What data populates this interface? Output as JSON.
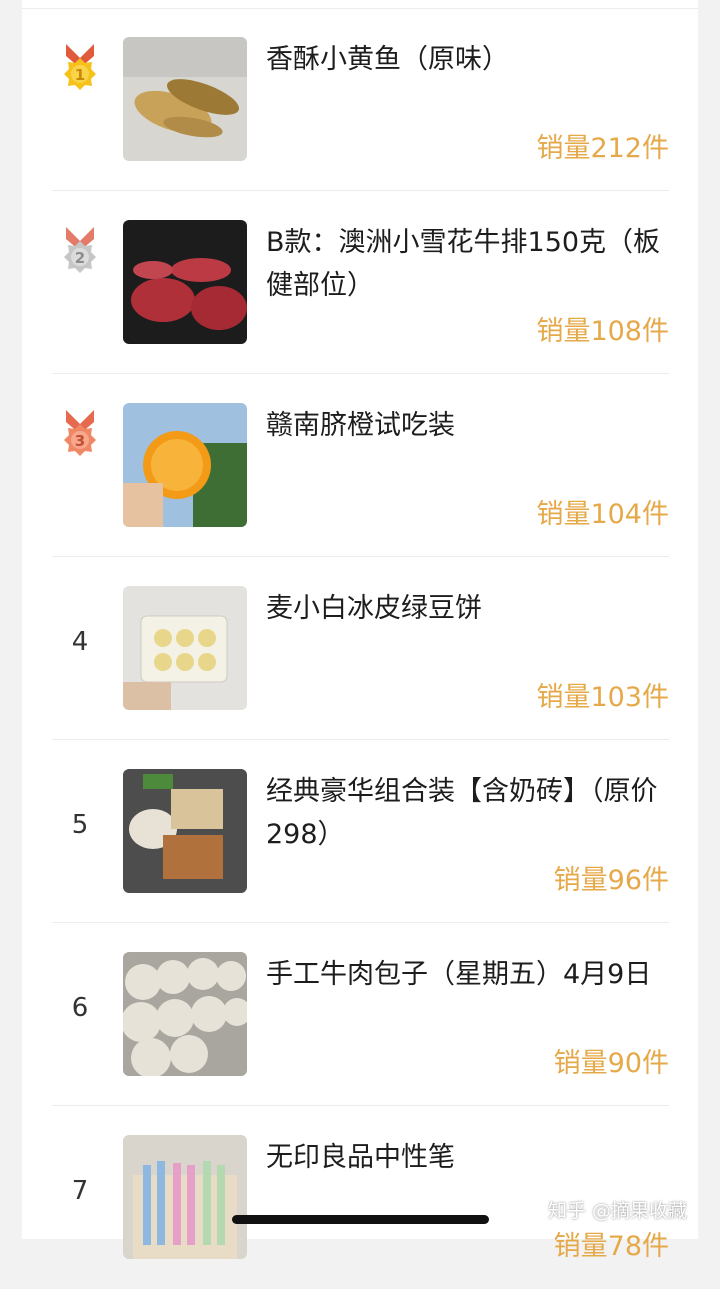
{
  "list": {
    "items": [
      {
        "rank": "1",
        "title": "香酥小黄鱼（原味）",
        "sales": "销量212件",
        "icon": "gold-medal-icon"
      },
      {
        "rank": "2",
        "title": "B款：澳洲小雪花牛排150克（板健部位）",
        "sales": "销量108件",
        "icon": "silver-medal-icon"
      },
      {
        "rank": "3",
        "title": "赣南脐橙试吃装",
        "sales": "销量104件",
        "icon": "bronze-medal-icon"
      },
      {
        "rank": "4",
        "title": "麦小白冰皮绿豆饼",
        "sales": "销量103件"
      },
      {
        "rank": "5",
        "title": "经典豪华组合装【含奶砖】（原价298）",
        "sales": "销量96件"
      },
      {
        "rank": "6",
        "title": "手工牛肉包子（星期五）4月9日",
        "sales": "销量90件"
      },
      {
        "rank": "7",
        "title": "无印良品中性笔",
        "sales": "销量78件"
      }
    ]
  },
  "watermark": "知乎 @摘果收藏",
  "colors": {
    "sales": "#e6a94a",
    "gold": "#f2b51c",
    "silver": "#b8b8b8",
    "bronze": "#ef8060"
  }
}
